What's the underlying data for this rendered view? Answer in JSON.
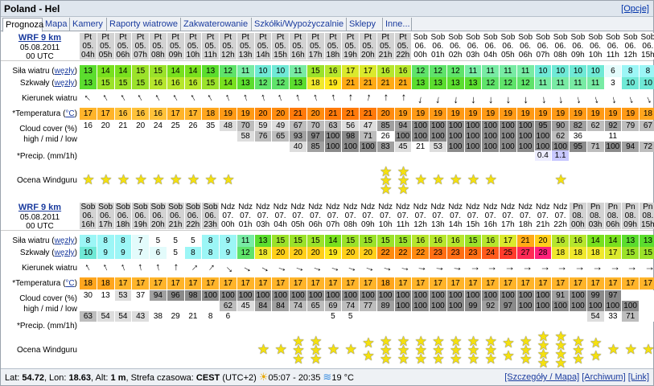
{
  "title": "Poland - Hel",
  "options_link": "[Opcje]",
  "tabs": [
    "Prognoza",
    "Mapa",
    "Kamery",
    "Raporty wiatrowe",
    "Zakwaterowanie",
    "Szkółki/Wypożyczalnie",
    "Sklepy",
    "Inne..."
  ],
  "labels": {
    "wind": "Siła wiatru (",
    "gusts": "Szkwały (",
    "unit_link": "węzły",
    "close": ")",
    "direction": "Kierunek wiatru",
    "temp": "*Temperatura (",
    "temp_unit": "°C",
    "cloud1": "Cloud cover (%)",
    "cloud2": "high / mid / low",
    "precip": "*Precip. (mm/1h)",
    "rating": "Ocena Windguru"
  },
  "blocks": [
    {
      "model": "WRF 9 km",
      "date": "05.08.2011",
      "utc": "00 UTC",
      "days": [
        "Pt",
        "Pt",
        "Pt",
        "Pt",
        "Pt",
        "Pt",
        "Pt",
        "Pt",
        "Pt",
        "Pt",
        "Pt",
        "Pt",
        "Pt",
        "Pt",
        "Pt",
        "Pt",
        "Pt",
        "Pt",
        "Pt",
        "Sob",
        "Sob",
        "Sob",
        "Sob",
        "Sob",
        "Sob",
        "Sob",
        "Sob",
        "Sob",
        "Sob",
        "Sob",
        "Sob",
        "Sob",
        "Sob"
      ],
      "dates": [
        "05.",
        "05.",
        "05.",
        "05.",
        "05.",
        "05.",
        "05.",
        "05.",
        "05.",
        "05.",
        "05.",
        "05.",
        "05.",
        "05.",
        "05.",
        "05.",
        "05.",
        "05.",
        "05.",
        "06.",
        "06.",
        "06.",
        "06.",
        "06.",
        "06.",
        "06.",
        "06.",
        "06.",
        "06.",
        "06.",
        "06.",
        "06.",
        "06."
      ],
      "hours": [
        "04h",
        "05h",
        "06h",
        "07h",
        "08h",
        "09h",
        "10h",
        "11h",
        "12h",
        "13h",
        "14h",
        "15h",
        "16h",
        "17h",
        "18h",
        "19h",
        "20h",
        "21h",
        "22h",
        "00h",
        "01h",
        "02h",
        "03h",
        "04h",
        "05h",
        "06h",
        "07h",
        "08h",
        "09h",
        "10h",
        "11h",
        "12h",
        "15h"
      ],
      "wind": [
        "13",
        "14",
        "14",
        "15",
        "15",
        "14",
        "14",
        "13",
        "12",
        "11",
        "10",
        "10",
        "11",
        "15",
        "16",
        "17",
        "17",
        "16",
        "16",
        "12",
        "12",
        "12",
        "11",
        "11",
        "11",
        "11",
        "10",
        "10",
        "10",
        "10",
        "6",
        "8",
        "8"
      ],
      "gusts": [
        "13",
        "15",
        "15",
        "15",
        "16",
        "16",
        "16",
        "15",
        "14",
        "13",
        "12",
        "12",
        "13",
        "18",
        "19",
        "21",
        "21",
        "21",
        "21",
        "13",
        "13",
        "13",
        "13",
        "12",
        "12",
        "12",
        "11",
        "11",
        "11",
        "11",
        "3",
        "10",
        "10"
      ],
      "dirs": [
        135,
        150,
        150,
        150,
        150,
        150,
        150,
        150,
        160,
        165,
        165,
        160,
        165,
        165,
        170,
        180,
        190,
        180,
        180,
        10,
        10,
        5,
        0,
        0,
        0,
        0,
        355,
        355,
        350,
        345,
        350,
        340,
        335
      ],
      "temp": [
        "17",
        "17",
        "16",
        "16",
        "16",
        "17",
        "17",
        "18",
        "19",
        "19",
        "20",
        "20",
        "21",
        "20",
        "21",
        "21",
        "21",
        "20",
        "19",
        "19",
        "19",
        "19",
        "19",
        "19",
        "19",
        "19",
        "19",
        "19",
        "19",
        "19",
        "19",
        "19",
        "18"
      ],
      "cc_high": [
        "16",
        "20",
        "21",
        "20",
        "24",
        "25",
        "26",
        "35",
        "48",
        "70",
        "59",
        "49",
        "67",
        "70",
        "63",
        "56",
        "47",
        "85",
        "94",
        "100",
        "100",
        "100",
        "100",
        "100",
        "100",
        "100",
        "95",
        "90",
        "82",
        "62",
        "92",
        "79",
        "67"
      ],
      "cc_mid": [
        "",
        "",
        "",
        "",
        "",
        "",
        "",
        "",
        "",
        "58",
        "76",
        "65",
        "93",
        "97",
        "100",
        "98",
        "71",
        "26",
        "100",
        "100",
        "100",
        "100",
        "100",
        "100",
        "100",
        "100",
        "100",
        "62",
        "36",
        "",
        "11",
        "",
        ""
      ],
      "cc_low": [
        "",
        "",
        "",
        "",
        "",
        "",
        "",
        "",
        "",
        "",
        "",
        "",
        "40",
        "85",
        "100",
        "100",
        "100",
        "83",
        "45",
        "21",
        "53",
        "100",
        "100",
        "100",
        "100",
        "100",
        "100",
        "100",
        "95",
        "71",
        "100",
        "94",
        "72"
      ],
      "precip": [
        "",
        "",
        "",
        "",
        "",
        "",
        "",
        "",
        "",
        "",
        "",
        "",
        "",
        "",
        "",
        "",
        "",
        "",
        "",
        "",
        "",
        "",
        "",
        "",
        "",
        "",
        "0.4",
        "1.1",
        "",
        "",
        "",
        "",
        ""
      ],
      "stars": [
        1,
        1,
        1,
        1,
        1,
        1,
        1,
        1,
        1,
        0,
        0,
        0,
        0,
        0,
        0,
        0,
        0,
        3,
        3,
        1,
        1,
        1,
        1,
        1,
        0,
        0,
        0,
        1,
        0,
        0,
        0,
        0,
        0
      ]
    },
    {
      "model": "WRF 9 km",
      "date": "05.08.2011",
      "utc": "00 UTC",
      "days": [
        "Sob",
        "Sob",
        "Sob",
        "Sob",
        "Sob",
        "Sob",
        "Sob",
        "Sob",
        "Ndz",
        "Ndz",
        "Ndz",
        "Ndz",
        "Ndz",
        "Ndz",
        "Ndz",
        "Ndz",
        "Ndz",
        "Ndz",
        "Ndz",
        "Ndz",
        "Ndz",
        "Ndz",
        "Ndz",
        "Ndz",
        "Ndz",
        "Ndz",
        "Ndz",
        "Ndz",
        "Pn",
        "Pn",
        "Pn",
        "Pn",
        "Pn"
      ],
      "dates": [
        "06.",
        "06.",
        "06.",
        "06.",
        "06.",
        "06.",
        "06.",
        "06.",
        "07.",
        "07.",
        "07.",
        "07.",
        "07.",
        "07.",
        "07.",
        "07.",
        "07.",
        "07.",
        "07.",
        "07.",
        "07.",
        "07.",
        "07.",
        "07.",
        "07.",
        "07.",
        "07.",
        "07.",
        "08.",
        "08.",
        "08.",
        "08.",
        "08."
      ],
      "hours": [
        "16h",
        "17h",
        "18h",
        "19h",
        "20h",
        "21h",
        "22h",
        "23h",
        "00h",
        "01h",
        "03h",
        "04h",
        "05h",
        "06h",
        "07h",
        "08h",
        "09h",
        "10h",
        "11h",
        "12h",
        "13h",
        "14h",
        "15h",
        "16h",
        "17h",
        "18h",
        "21h",
        "22h",
        "00h",
        "03h",
        "06h",
        "09h",
        "15h"
      ],
      "wind": [
        "8",
        "8",
        "8",
        "7",
        "5",
        "5",
        "5",
        "8",
        "9",
        "11",
        "13",
        "15",
        "15",
        "15",
        "14",
        "15",
        "15",
        "15",
        "15",
        "16",
        "16",
        "16",
        "15",
        "16",
        "17",
        "21",
        "20",
        "16",
        "16",
        "14",
        "14",
        "13",
        "13"
      ],
      "gusts": [
        "10",
        "9",
        "9",
        "7",
        "6",
        "5",
        "8",
        "8",
        "9",
        "12",
        "18",
        "20",
        "20",
        "20",
        "19",
        "20",
        "20",
        "22",
        "22",
        "22",
        "23",
        "23",
        "23",
        "24",
        "25",
        "27",
        "28",
        "18",
        "18",
        "18",
        "17",
        "15",
        "15"
      ],
      "dirs": [
        150,
        155,
        160,
        170,
        170,
        180,
        225,
        220,
        315,
        300,
        300,
        290,
        290,
        290,
        290,
        290,
        290,
        285,
        280,
        275,
        275,
        275,
        270,
        270,
        270,
        270,
        270,
        270,
        270,
        270,
        270,
        270,
        270
      ],
      "temp": [
        "18",
        "18",
        "17",
        "17",
        "17",
        "17",
        "17",
        "17",
        "17",
        "17",
        "17",
        "17",
        "17",
        "17",
        "17",
        "17",
        "17",
        "18",
        "17",
        "17",
        "17",
        "17",
        "17",
        "17",
        "17",
        "17",
        "17",
        "17",
        "17",
        "17",
        "17",
        "17",
        "17"
      ],
      "cc_high": [
        "30",
        "13",
        "53",
        "37",
        "94",
        "96",
        "98",
        "100",
        "100",
        "100",
        "100",
        "100",
        "100",
        "100",
        "100",
        "100",
        "100",
        "100",
        "100",
        "100",
        "100",
        "100",
        "100",
        "100",
        "100",
        "100",
        "100",
        "91",
        "100",
        "99",
        "97",
        "",
        ""
      ],
      "cc_mid": [
        "",
        "",
        "",
        "",
        "",
        "",
        "",
        "",
        "62",
        "45",
        "84",
        "84",
        "74",
        "65",
        "69",
        "74",
        "77",
        "89",
        "100",
        "100",
        "100",
        "100",
        "99",
        "92",
        "97",
        "100",
        "100",
        "100",
        "100",
        "100",
        "100",
        "100",
        "",
        ""
      ],
      "cc_low": [
        "63",
        "54",
        "54",
        "43",
        "38",
        "29",
        "21",
        "8",
        "6",
        "",
        "",
        "",
        "",
        "",
        "5",
        "5",
        "",
        "",
        "",
        "",
        "",
        "",
        "",
        "",
        "",
        "",
        "",
        "",
        "",
        "54",
        "33",
        "71",
        "",
        ""
      ],
      "precip": [
        "",
        "",
        "",
        "",
        "",
        "",
        "",
        "",
        "",
        "",
        "",
        "",
        "",
        "",
        "",
        "",
        "",
        "",
        "",
        "",
        "",
        "",
        "",
        "",
        "",
        "",
        "",
        "",
        "",
        "",
        "",
        "",
        ""
      ],
      "stars": [
        0,
        0,
        0,
        0,
        0,
        0,
        0,
        0,
        0,
        0,
        1,
        1,
        3,
        3,
        1,
        1,
        2,
        3,
        3,
        3,
        3,
        3,
        3,
        3,
        2,
        3,
        4,
        4,
        3,
        2,
        1,
        1,
        1
      ]
    }
  ],
  "footer": {
    "lat_label": "Lat: ",
    "lat": "54.72",
    "lon_label": ", Lon: ",
    "lon": "18.63",
    "alt_label": ", Alt: ",
    "alt": "1 m",
    "tz_label": ", Strefa czasowa: ",
    "tz": "CEST",
    "tz_offset": " (UTC+2) ",
    "sun": "05:07 - 20:35",
    "water": "19 °C",
    "links": [
      "[Szczegóły / Mapa]",
      "[Archiwum]",
      "[Link]"
    ]
  }
}
